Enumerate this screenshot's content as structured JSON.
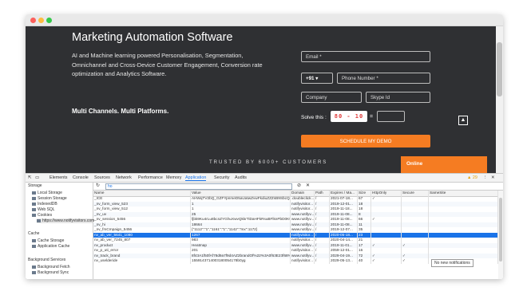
{
  "page": {
    "title": "Marketing Automation Software",
    "description": "AI and Machine learning powered Personalisation, Segmentation, Omnichannel and Cross-Device Customer Engagement, Conversion rate optimization and Analytics Software.",
    "tagline": "Multi Channels. Multi Platforms.",
    "email_placeholder": "Email *",
    "country_code": "+91",
    "country_arrow": "▾",
    "phone_placeholder": "Phone Number *",
    "company_placeholder": "Company",
    "skype_placeholder": "Skype Id",
    "captcha_label": "Solve this :",
    "captcha_expr": "80 - 10",
    "captcha_eq": "=",
    "cta_label": "SCHEDULE MY DEMO",
    "trusted": "TRUSTED BY 6000+ CUSTOMERS",
    "online_label": "Online",
    "scroll_up_icon": "chevron-up-icon"
  },
  "devtools": {
    "tabs": [
      "Elements",
      "Console",
      "Sources",
      "Network",
      "Performance",
      "Memory",
      "Application",
      "Security",
      "Audits"
    ],
    "active_tab": "Application",
    "warning_count": "▲ 29",
    "filter_value": "ho",
    "sidebar": {
      "storage_header": "Storage",
      "items": [
        "Local Storage",
        "Session Storage",
        "IndexedDB",
        "Web SQL",
        "Cookies",
        "https://www.notifyvisitors.com"
      ],
      "cache_header": "Cache",
      "cache_items": [
        "Cache Storage",
        "Application Cache"
      ],
      "bg_header": "Background Services",
      "bg_items": [
        "Background Fetch",
        "Background Sync"
      ]
    },
    "columns": [
      "Name",
      "Value",
      "Domain",
      "Path",
      "Expires / Ma...",
      "Size",
      "HttpOnly",
      "Secure",
      "SameSite"
    ],
    "rows": [
      [
        "_ICE",
        "AHWqTV2bQ_GZFYpnmeD5aUatwZvwFkdiuZZZsB9SbcQp9N-4uZpHWfo...",
        ".doubleclick...",
        "/",
        "2021-07-18...",
        "67",
        "✓",
        "",
        ""
      ],
      [
        "_nv_form_view_523",
        "1",
        "notifyvisitor...",
        "/",
        "2019-12-01...",
        "18",
        "",
        "",
        ""
      ],
      [
        "_nv_form_view_512",
        "1",
        "notifyvisitor...",
        "/",
        "2019-11-18...",
        "18",
        "",
        "",
        ""
      ],
      [
        "_nv_uv",
        "25",
        "www.notifyv...",
        "/",
        "2019-11-08...",
        "8",
        "",
        "",
        ""
      ],
      [
        "_nv_session_5456",
        "fjbk9Ku4rLu8bcnZYGhuXwvQkkrTiDaHFkRsuBFlknPbD0K9r0Y",
        "www.notifyv...",
        "/",
        "2019-11-08...",
        "66",
        "✓",
        "",
        ""
      ],
      [
        "_nv_hi",
        "18664",
        "www.notifyv...",
        "/",
        "2019-11-08...",
        "11",
        "",
        "",
        ""
      ],
      [
        "_nv_frsCmpaign_5456",
        "{\"1112\":\"1\",\"1161\":\"1\",\"1142\":\"mx\":1172}",
        "www.notifyv...",
        "/",
        "2019-12-07...",
        "35",
        "",
        "",
        ""
      ],
      [
        "nv_ab_ver_5641_1080",
        "1267",
        "notifyvisitor...",
        "/",
        "2020-05-18...",
        "23",
        "",
        "",
        ""
      ],
      [
        "nv_ab_ver_7245_807",
        "983",
        "notifyvisitor...",
        "/",
        "2020-04-14...",
        "21",
        "",
        "",
        ""
      ],
      [
        "nv_product",
        "Heatmap",
        "www.notifyv...",
        "/",
        "2019-11-01...",
        "17",
        "✓",
        "✓",
        ""
      ],
      [
        "nv_p_uti_error",
        "201",
        "notifyvisitor...",
        "/",
        "2059-12-01...",
        "16",
        "",
        "",
        ""
      ],
      [
        "nv_track_brand",
        "8f43A1f50fAf78d9a7f9d4AZ2brandOf%22%3A0f63E23f68%2...",
        "www.notifyv...",
        "/",
        "2029-04-19...",
        "72",
        "✓",
        "✓",
        ""
      ],
      [
        "nv_uselderide",
        "1559143714003180054178b0yg",
        "notifyvisitor...",
        "/",
        "2029-05-13...",
        "40",
        "✓",
        "✓",
        ""
      ]
    ],
    "selected_row": 7,
    "tooltip": "No new notifications"
  }
}
